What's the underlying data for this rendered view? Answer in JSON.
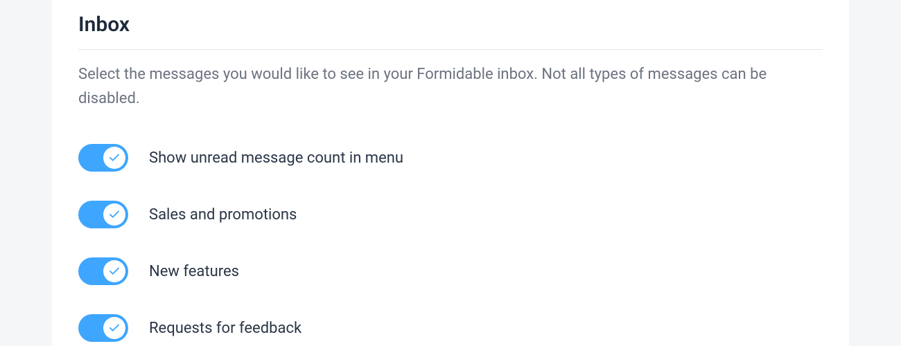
{
  "section": {
    "title": "Inbox",
    "description": "Select the messages you would like to see in your Formidable inbox. Not all types of messages can be disabled."
  },
  "options": [
    {
      "label": "Show unread message count in menu",
      "enabled": true
    },
    {
      "label": "Sales and promotions",
      "enabled": true
    },
    {
      "label": "New features",
      "enabled": true
    },
    {
      "label": "Requests for feedback",
      "enabled": true
    }
  ]
}
